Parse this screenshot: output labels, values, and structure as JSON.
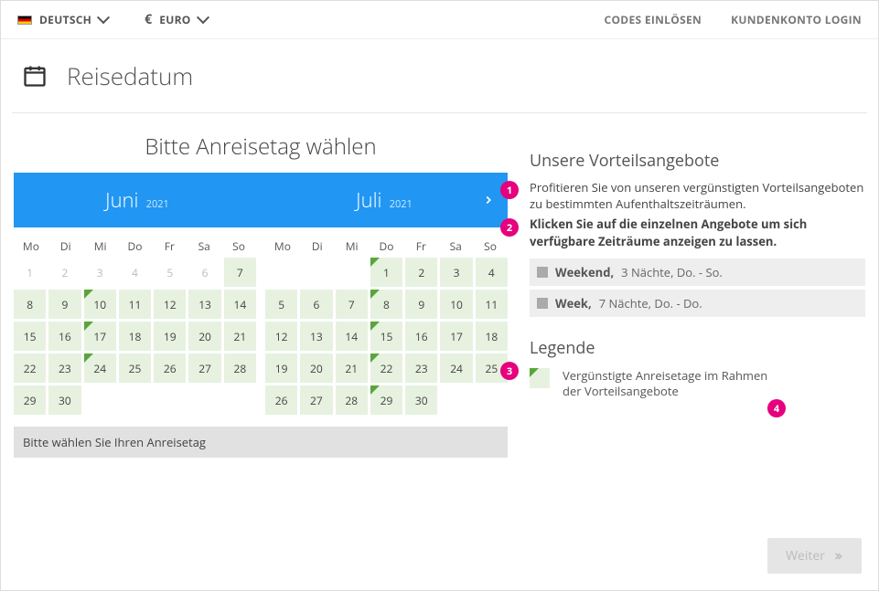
{
  "topbar": {
    "language_label": "DEUTSCH",
    "currency_symbol": "€",
    "currency_label": "EURO",
    "redeem_codes": "CODES EINLÖSEN",
    "account_login": "KUNDENKONTO LOGIN"
  },
  "section": {
    "title": "Reisedatum"
  },
  "calendar": {
    "choose_title": "Bitte Anreisetag wählen",
    "status_text": "Bitte wählen Sie Ihren Anreisetag",
    "dow": [
      "Mo",
      "Di",
      "Mi",
      "Do",
      "Fr",
      "Sa",
      "So"
    ],
    "months": [
      {
        "name": "Juni",
        "year": "2021",
        "lead_blanks": 0,
        "days": [
          {
            "n": 1,
            "disabled": true
          },
          {
            "n": 2,
            "disabled": true
          },
          {
            "n": 3,
            "disabled": true
          },
          {
            "n": 4,
            "disabled": true
          },
          {
            "n": 5,
            "disabled": true
          },
          {
            "n": 6,
            "disabled": true
          },
          {
            "n": 7,
            "avail": true
          },
          {
            "n": 8,
            "avail": true
          },
          {
            "n": 9,
            "avail": true
          },
          {
            "n": 10,
            "avail": true,
            "offer": true
          },
          {
            "n": 11,
            "avail": true
          },
          {
            "n": 12,
            "avail": true
          },
          {
            "n": 13,
            "avail": true
          },
          {
            "n": 14,
            "avail": true
          },
          {
            "n": 15,
            "avail": true
          },
          {
            "n": 16,
            "avail": true
          },
          {
            "n": 17,
            "avail": true,
            "offer": true
          },
          {
            "n": 18,
            "avail": true
          },
          {
            "n": 19,
            "avail": true
          },
          {
            "n": 20,
            "avail": true
          },
          {
            "n": 21,
            "avail": true
          },
          {
            "n": 22,
            "avail": true
          },
          {
            "n": 23,
            "avail": true
          },
          {
            "n": 24,
            "avail": true,
            "offer": true
          },
          {
            "n": 25,
            "avail": true
          },
          {
            "n": 26,
            "avail": true
          },
          {
            "n": 27,
            "avail": true
          },
          {
            "n": 28,
            "avail": true
          },
          {
            "n": 29,
            "avail": true
          },
          {
            "n": 30,
            "avail": true
          }
        ]
      },
      {
        "name": "Juli",
        "year": "2021",
        "lead_blanks": 3,
        "days": [
          {
            "n": 1,
            "avail": true,
            "offer": true
          },
          {
            "n": 2,
            "avail": true
          },
          {
            "n": 3,
            "avail": true
          },
          {
            "n": 4,
            "avail": true
          },
          {
            "n": 5,
            "avail": true
          },
          {
            "n": 6,
            "avail": true
          },
          {
            "n": 7,
            "avail": true
          },
          {
            "n": 8,
            "avail": true,
            "offer": true
          },
          {
            "n": 9,
            "avail": true
          },
          {
            "n": 10,
            "avail": true
          },
          {
            "n": 11,
            "avail": true
          },
          {
            "n": 12,
            "avail": true
          },
          {
            "n": 13,
            "avail": true
          },
          {
            "n": 14,
            "avail": true
          },
          {
            "n": 15,
            "avail": true,
            "offer": true
          },
          {
            "n": 16,
            "avail": true
          },
          {
            "n": 17,
            "avail": true
          },
          {
            "n": 18,
            "avail": true
          },
          {
            "n": 19,
            "avail": true
          },
          {
            "n": 20,
            "avail": true
          },
          {
            "n": 21,
            "avail": true
          },
          {
            "n": 22,
            "avail": true,
            "offer": true
          },
          {
            "n": 23,
            "avail": true
          },
          {
            "n": 24,
            "avail": true
          },
          {
            "n": 25,
            "avail": true
          },
          {
            "n": 26,
            "avail": true
          },
          {
            "n": 27,
            "avail": true
          },
          {
            "n": 28,
            "avail": true
          },
          {
            "n": 29,
            "avail": true,
            "offer": true
          },
          {
            "n": 30,
            "avail": true
          }
        ]
      }
    ]
  },
  "offers": {
    "title": "Unsere Vorteilsangebote",
    "intro": "Profitieren Sie von unseren vergünstigten Vorteilsangeboten zu bestimmten Aufenthaltszeiträumen.",
    "hint": "Klicken Sie auf die einzelnen Angebote um sich verfügbare Zeiträume anzeigen zu lassen.",
    "items": [
      {
        "name": "Weekend,",
        "desc": "3 Nächte, Do. - So."
      },
      {
        "name": "Week,",
        "desc": "7 Nächte, Do. - Do."
      }
    ]
  },
  "legend": {
    "title": "Legende",
    "text": "Vergünstigte Anreisetage im Rahmen der Vorteilsangebote"
  },
  "next_button": "Weiter",
  "annotations": [
    "1",
    "2",
    "3",
    "4"
  ]
}
